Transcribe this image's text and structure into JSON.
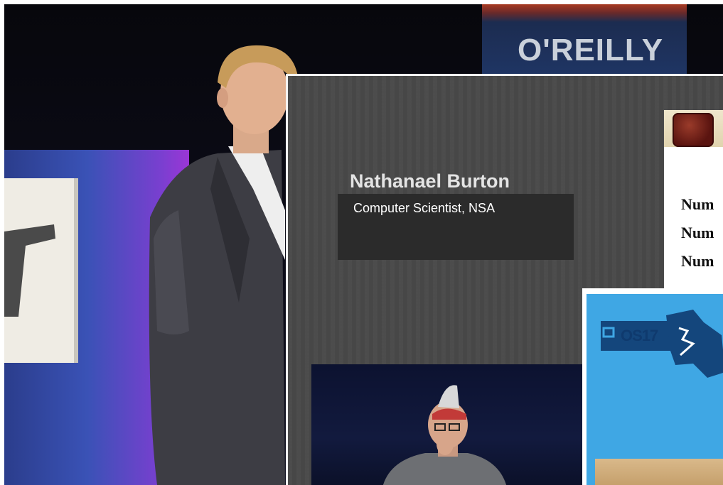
{
  "speaker": {
    "name": "Nathanael Burton",
    "title": "Computer Scientist, NSA"
  },
  "background": {
    "logo_text": "O'REILLY"
  },
  "document_card": {
    "lines": [
      "Num",
      "Num",
      "Num"
    ]
  },
  "os_card": {
    "badge_text": "OS17"
  },
  "colors": {
    "panel": "#494949",
    "caption_box": "#2b2b2b",
    "os_blue": "#3fa7e4",
    "stage_blue": "#3a52b6"
  }
}
